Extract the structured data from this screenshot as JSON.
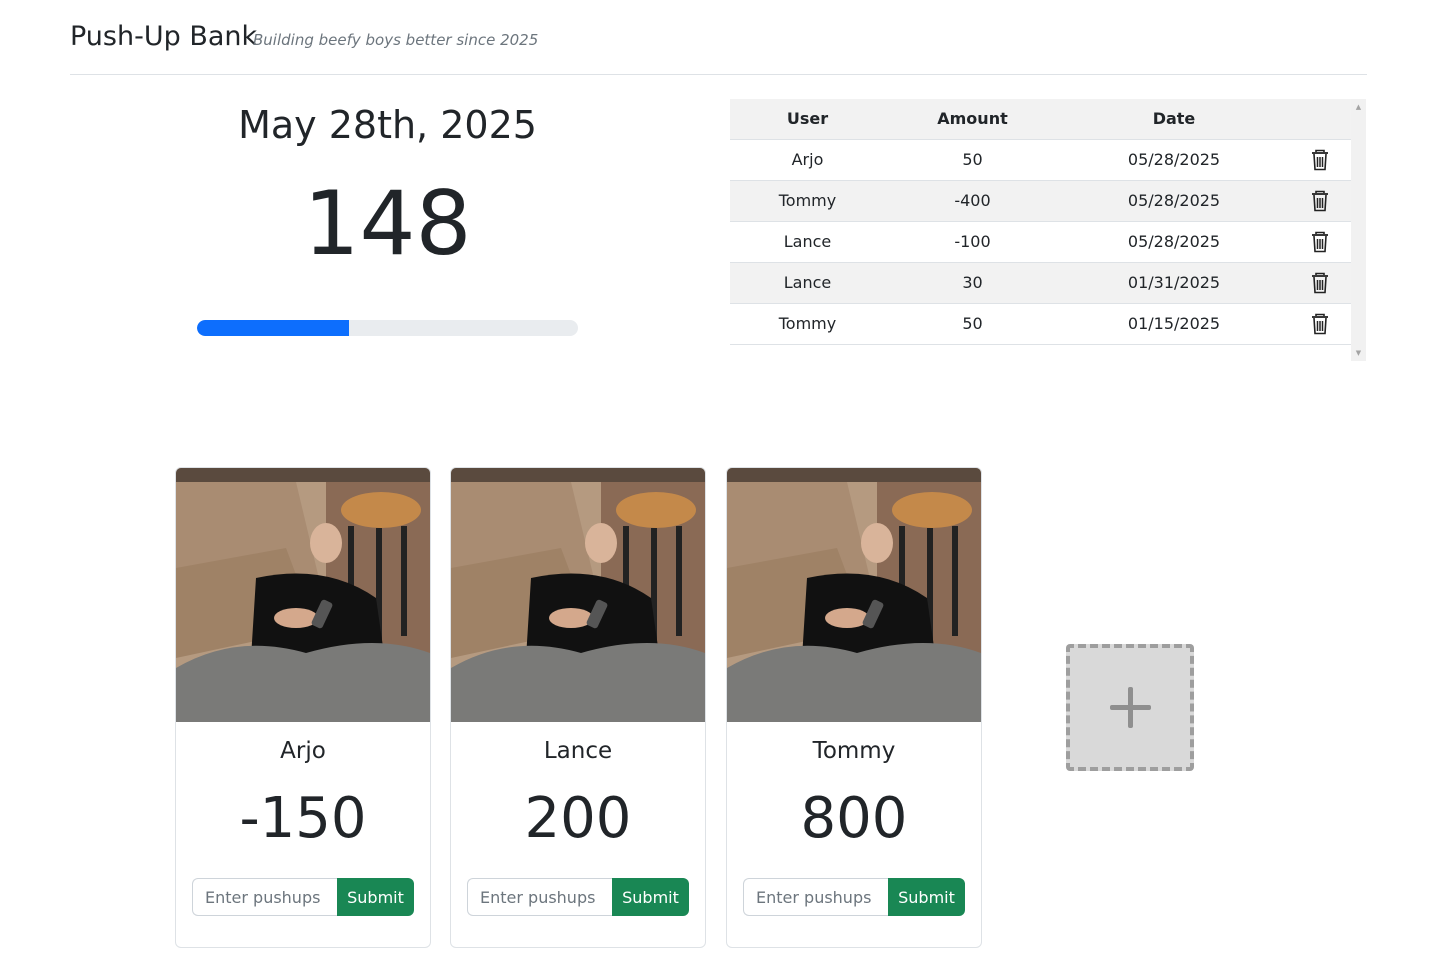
{
  "header": {
    "brand": "Push-Up Bank",
    "tagline": "Building beefy boys better since 2025"
  },
  "summary": {
    "date": "May 28th, 2025",
    "total": "148",
    "progress_fraction": 0.4,
    "progress_color": "#0d6efd"
  },
  "transactions": {
    "headers": {
      "user": "User",
      "amount": "Amount",
      "date": "Date"
    },
    "rows": [
      {
        "user": "Arjo",
        "amount": "50",
        "date": "05/28/2025"
      },
      {
        "user": "Tommy",
        "amount": "-400",
        "date": "05/28/2025"
      },
      {
        "user": "Lance",
        "amount": "-100",
        "date": "05/28/2025"
      },
      {
        "user": "Lance",
        "amount": "30",
        "date": "01/31/2025"
      },
      {
        "user": "Tommy",
        "amount": "50",
        "date": "01/15/2025"
      }
    ],
    "delete_icon": "trash-icon"
  },
  "users": [
    {
      "name": "Arjo",
      "score": "-150",
      "placeholder": "Enter pushups",
      "submit_label": "Submit"
    },
    {
      "name": "Lance",
      "score": "200",
      "placeholder": "Enter pushups",
      "submit_label": "Submit"
    },
    {
      "name": "Tommy",
      "score": "800",
      "placeholder": "Enter pushups",
      "submit_label": "Submit"
    }
  ],
  "add_user": {
    "icon": "plus-icon"
  },
  "colors": {
    "submit": "#198754",
    "accent": "#0d6efd"
  }
}
